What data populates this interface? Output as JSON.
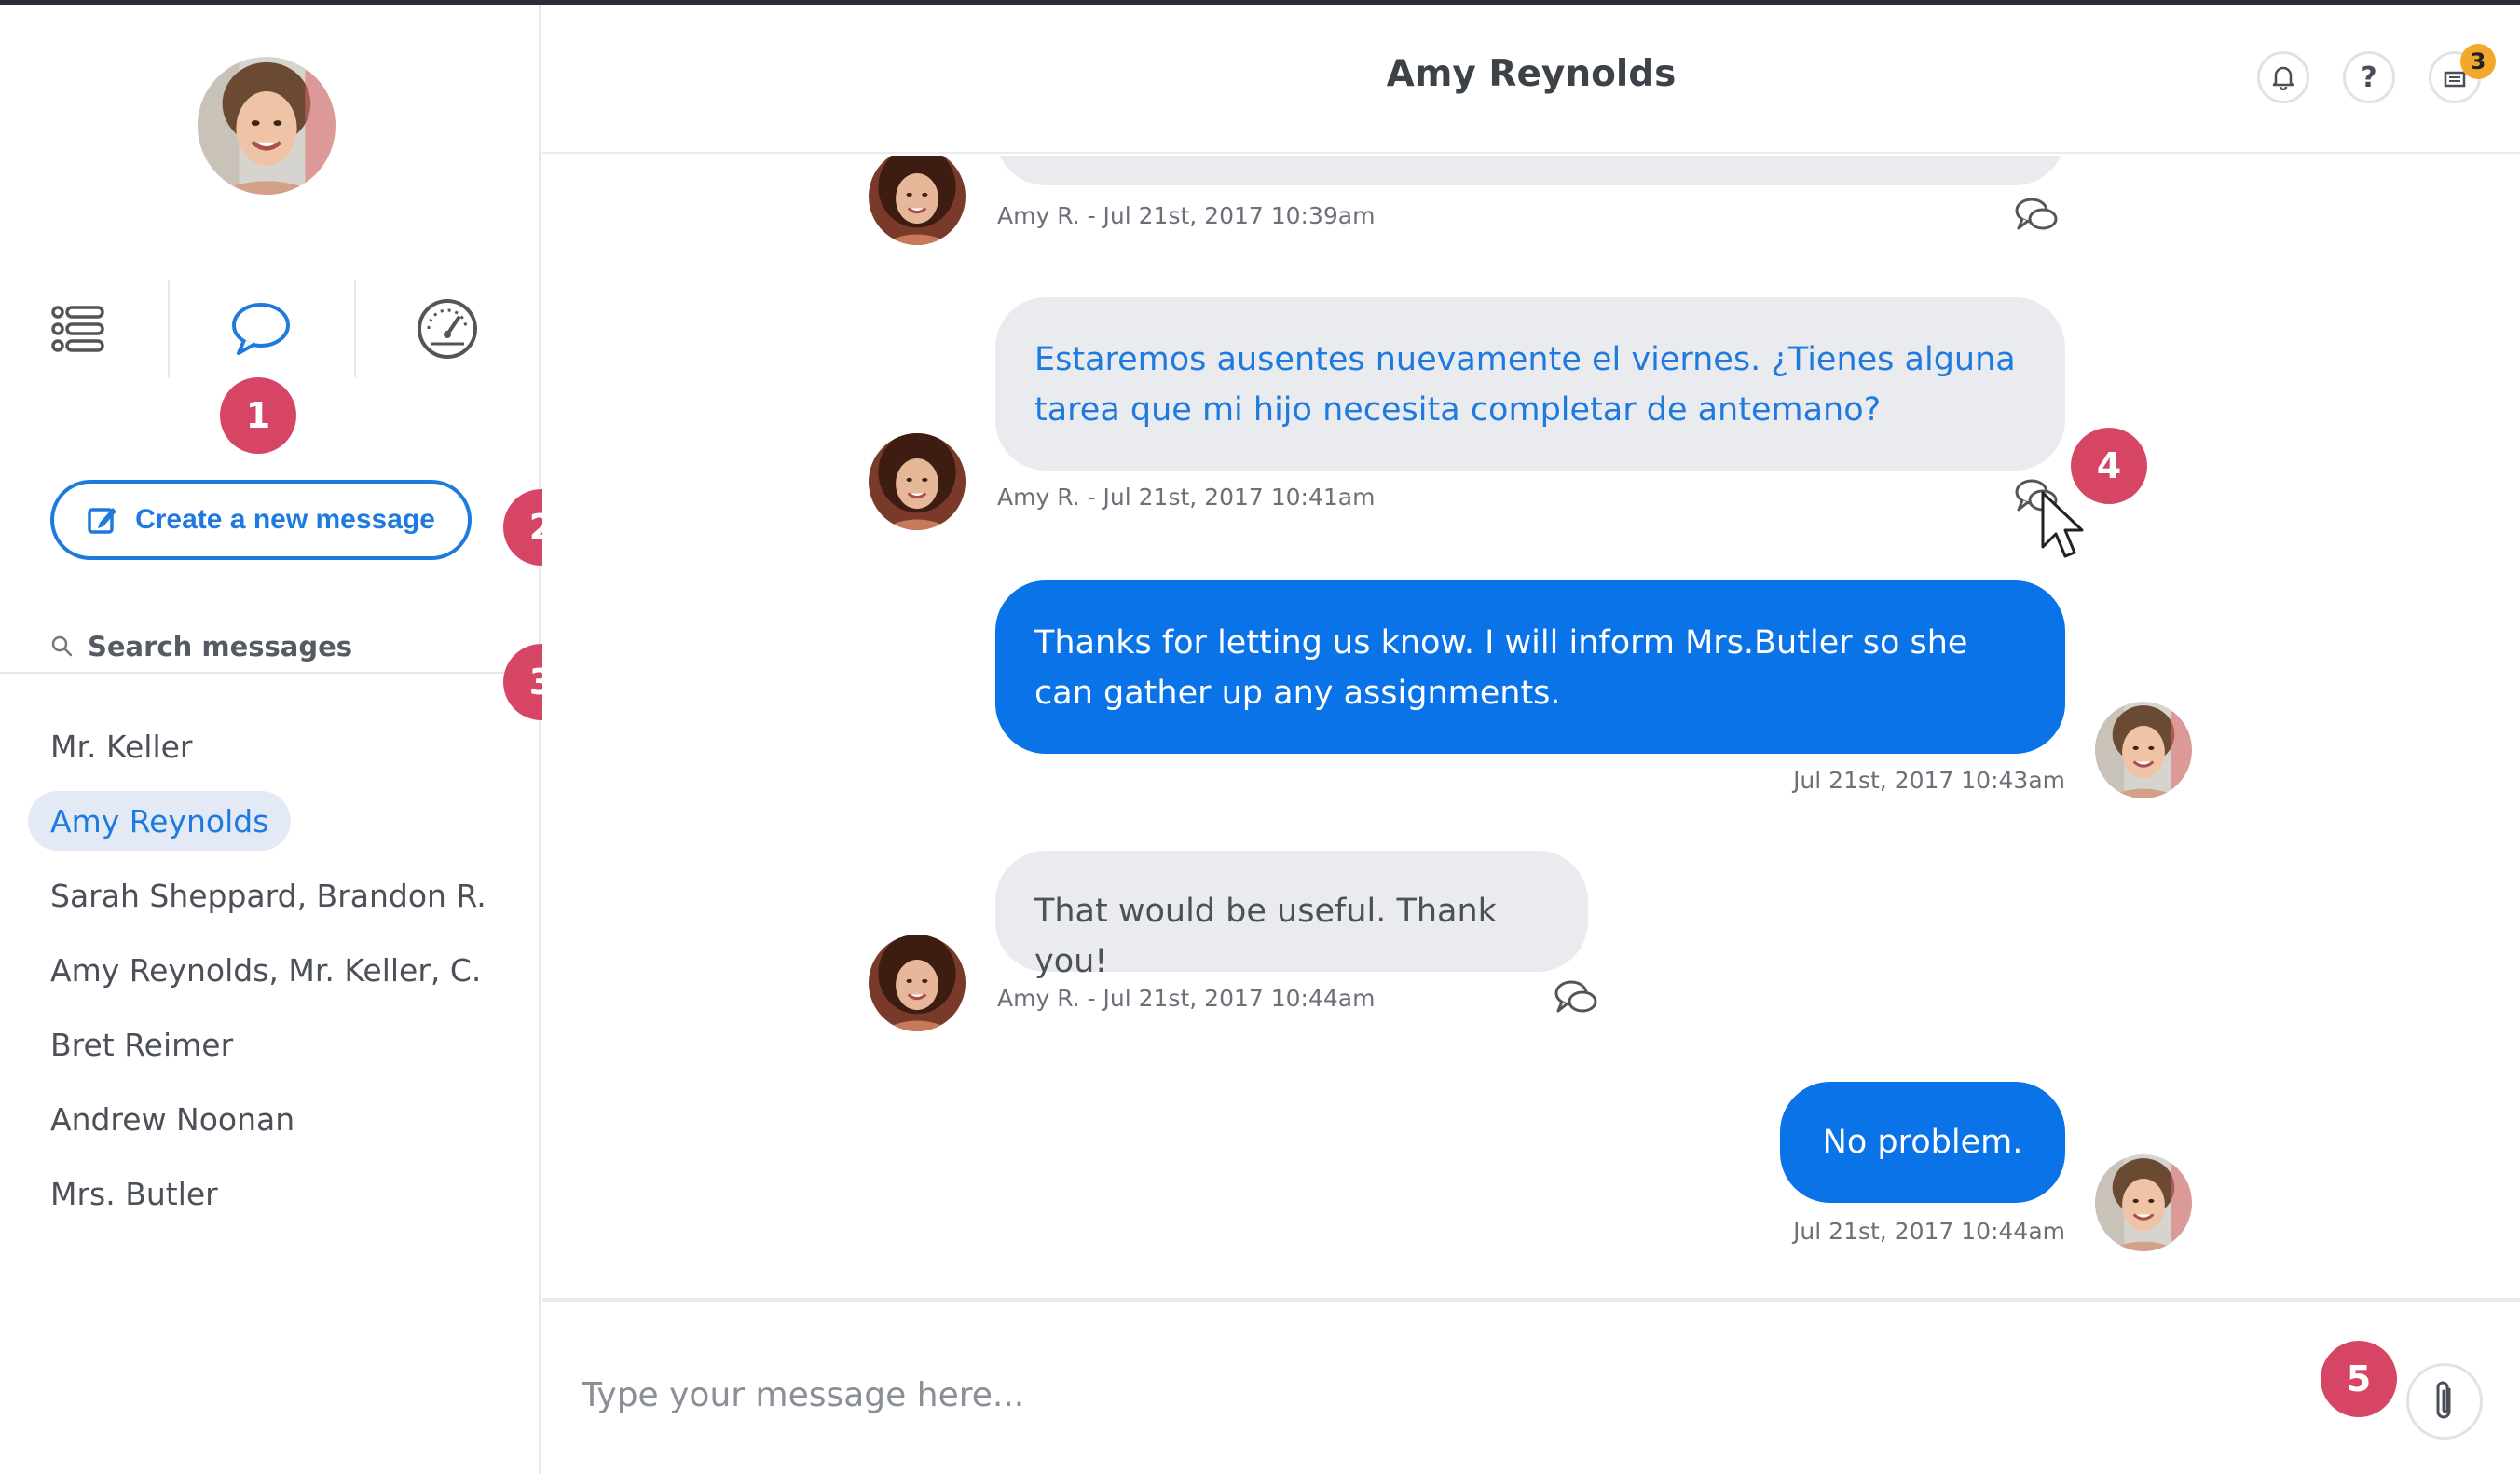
{
  "header": {
    "title": "Amy Reynolds",
    "notifications_count": "3",
    "help_label": "?"
  },
  "sidebar": {
    "create_button_label": "Create a new message",
    "search_placeholder": "Search messages",
    "conversations": [
      {
        "label": "Mr. Keller",
        "active": false
      },
      {
        "label": "Amy Reynolds",
        "active": true
      },
      {
        "label": "Sarah Sheppard, Brandon R.",
        "active": false
      },
      {
        "label": "Amy Reynolds, Mr. Keller, C.",
        "active": false
      },
      {
        "label": "Bret Reimer",
        "active": false
      },
      {
        "label": "Andrew Noonan",
        "active": false
      },
      {
        "label": "Mrs. Butler",
        "active": false
      }
    ]
  },
  "callouts": [
    "1",
    "2",
    "3",
    "4",
    "5"
  ],
  "messages": [
    {
      "direction": "in",
      "text": "",
      "meta": "Amy R. - Jul 21st, 2017 10:39am"
    },
    {
      "direction": "in",
      "text": "Estaremos ausentes nuevamente el viernes. ¿Tienes alguna tarea que mi hijo necesita completar de antemano?",
      "meta": "Amy R. - Jul 21st, 2017 10:41am"
    },
    {
      "direction": "out",
      "text": "Thanks for letting us know. I will inform Mrs.Butler so she can gather up any assignments.",
      "meta": "Jul 21st, 2017 10:43am"
    },
    {
      "direction": "in",
      "text": "That would be useful. Thank you!",
      "meta": "Amy R. - Jul 21st, 2017 10:44am"
    },
    {
      "direction": "out",
      "text": "No problem.",
      "meta": "Jul 21st, 2017 10:44am"
    }
  ],
  "composer": {
    "placeholder": "Type your message here..."
  },
  "colors": {
    "accent": "#1f7ae0",
    "outgoing_bubble": "#0a73e8",
    "incoming_bubble": "#eaebee",
    "callout_badge": "#d64664",
    "notification_badge": "#f2a82a"
  },
  "icons": [
    "list-icon",
    "chat-bubble-icon",
    "dashboard-gauge-icon",
    "edit-icon",
    "search-icon",
    "bell-icon",
    "help-icon",
    "inbox-icon",
    "reply-thread-icon",
    "paperclip-icon",
    "cursor-pointer-icon"
  ]
}
